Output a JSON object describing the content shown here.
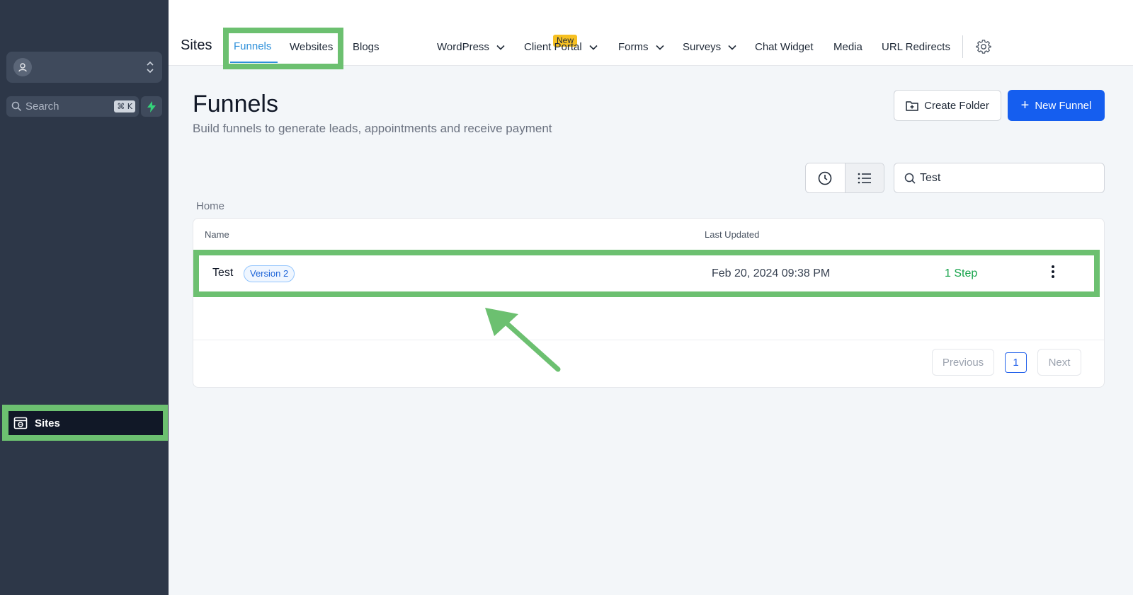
{
  "sidebar": {
    "search_placeholder": "Search",
    "search_shortcut": "⌘ K",
    "nav_sites_label": "Sites"
  },
  "topbar": {
    "title": "Sites",
    "tabs": [
      {
        "label": "Funnels"
      },
      {
        "label": "Websites"
      },
      {
        "label": "Blogs"
      },
      {
        "label": "WordPress"
      },
      {
        "label": "Client Portal"
      },
      {
        "label": "Forms"
      },
      {
        "label": "Surveys"
      },
      {
        "label": "Chat Widget"
      },
      {
        "label": "Media"
      },
      {
        "label": "URL Redirects"
      }
    ],
    "blogs_badge": "New"
  },
  "page": {
    "title": "Funnels",
    "subtitle": "Build funnels to generate leads, appointments and receive payment",
    "create_folder_label": "Create Folder",
    "new_funnel_label": "New Funnel",
    "search_value": "Test",
    "breadcrumb": "Home"
  },
  "table": {
    "columns": [
      "Name",
      "Last Updated"
    ],
    "rows": [
      {
        "name": "Test",
        "badge": "Version 2",
        "last_updated": "Feb 20, 2024 09:38 PM",
        "steps": "1 Step"
      }
    ]
  },
  "pagination": {
    "previous_label": "Previous",
    "current_page": "1",
    "next_label": "Next"
  },
  "colors": {
    "sidebar_bg": "#2d3748",
    "highlight": "#6cc070",
    "primary": "#155eef",
    "active_tab": "#2e90da",
    "steps_green": "#16a34a"
  }
}
